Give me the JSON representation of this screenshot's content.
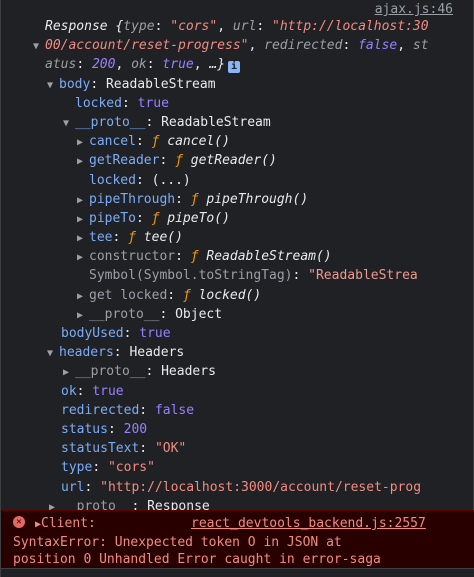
{
  "source_link": "ajax.js:46",
  "response": {
    "label": "Response",
    "summary_open": " {",
    "type_key": "type",
    "type_val": "\"cors\"",
    "url_key": "url",
    "url_val_1": "\"http://localhost:30",
    "url_val_2": "00/account/reset-progress\"",
    "redirected_key": "redirected",
    "redirected_val": "false",
    "status_key_cont": "st",
    "status_key_rest": "atus",
    "status_val": "200",
    "ok_key": "ok",
    "ok_val": "true",
    "ellipsis": "…}",
    "info_icon": "i"
  },
  "tree": {
    "body_key": "body",
    "body_val": "ReadableStream",
    "locked_key": "locked",
    "locked_val": "true",
    "proto_key": "__proto__",
    "proto_val": "ReadableStream",
    "cancel_key": "cancel",
    "cancel_val": "cancel()",
    "getReader_key": "getReader",
    "getReader_val": "getReader()",
    "locked2_key": "locked",
    "locked2_val": "(...)",
    "pipeThrough_key": "pipeThrough",
    "pipeThrough_val": "pipeThrough()",
    "pipeTo_key": "pipeTo",
    "pipeTo_val": "pipeTo()",
    "tee_key": "tee",
    "tee_val": "tee()",
    "constructor_key": "constructor",
    "constructor_val": "ReadableStream()",
    "symbol_key": "Symbol(Symbol.toStringTag)",
    "symbol_val": "\"ReadableStrea",
    "get_locked_key": "get locked",
    "get_locked_val": "locked()",
    "proto2_key": "__proto__",
    "proto2_val": "Object",
    "bodyUsed_key": "bodyUsed",
    "bodyUsed_val": "true",
    "headers_key": "headers",
    "headers_val": "Headers",
    "proto3_key": "__proto__",
    "proto3_val": "Headers",
    "ok_key": "ok",
    "ok_val": "true",
    "redirected_key": "redirected",
    "redirected_val": "false",
    "status_key": "status",
    "status_val": "200",
    "statusText_key": "statusText",
    "statusText_val": "\"OK\"",
    "type_key": "type",
    "type_val": "\"cors\"",
    "url_key": "url",
    "url_val": "\"http://localhost:3000/account/reset-prog",
    "proto4_key": "__proto__",
    "proto4_val": "Response",
    "f_keyword": "ƒ"
  },
  "error": {
    "client_label": "Client:",
    "source": "react_devtools_backend.js:2557",
    "line1": "SyntaxError: Unexpected token O in JSON at",
    "line2": "position 0 Unhandled Error caught in error-saga"
  },
  "icons": {
    "collapse": "arrow-down-icon",
    "expand": "arrow-right-icon",
    "error": "error-circle-icon",
    "info": "info-icon"
  },
  "colors": {
    "background": "#202124",
    "error_background": "#290000",
    "key": "#7cacf8",
    "string": "#f28b82",
    "boolean": "#9980ff",
    "error_text": "#f28b82"
  }
}
